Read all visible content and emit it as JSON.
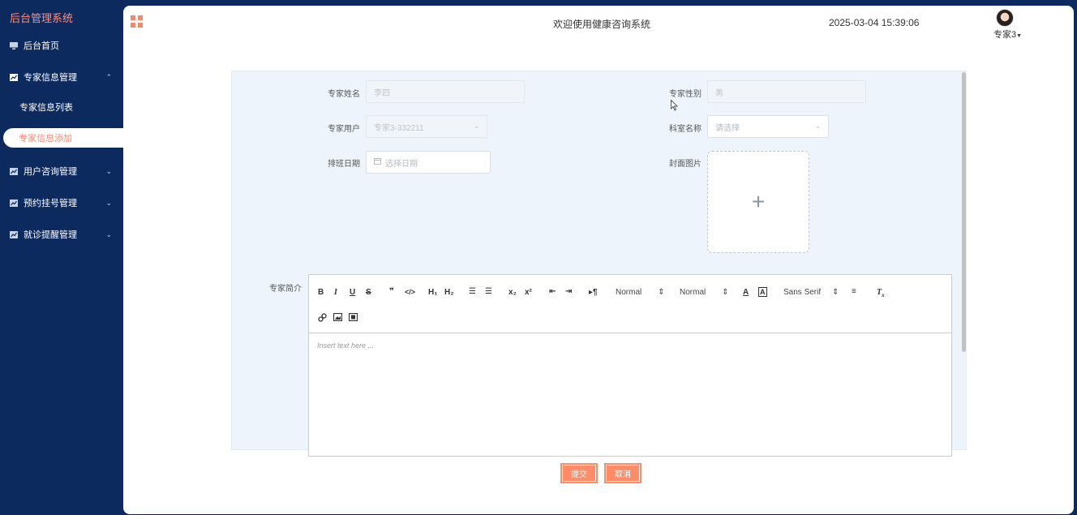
{
  "sidebar": {
    "brand": "后台管理系统",
    "items": [
      {
        "label": "后台首页",
        "icon": "monitor-icon"
      },
      {
        "label": "专家信息管理",
        "icon": "chart-icon",
        "arrow": "⌃"
      },
      {
        "label": "专家信息列表"
      },
      {
        "label": "专家信息添加"
      },
      {
        "label": "用户咨询管理",
        "icon": "chart-icon",
        "arrow": "⌄"
      },
      {
        "label": "预约挂号管理",
        "icon": "chart-icon",
        "arrow": "⌄"
      },
      {
        "label": "就诊提醒管理",
        "icon": "chart-icon",
        "arrow": "⌄"
      }
    ]
  },
  "header": {
    "title": "欢迎使用健康咨询系统",
    "datetime": "2025-03-04 15:39:06",
    "user": "专家3"
  },
  "form": {
    "expert_name_label": "专家姓名",
    "expert_name_value": "李四",
    "expert_gender_label": "专家性别",
    "expert_gender_value": "男",
    "expert_user_label": "专家用户",
    "expert_user_value": "专家3-332211",
    "department_label": "科室名称",
    "department_placeholder": "请选择",
    "schedule_label": "排班日期",
    "schedule_placeholder": "选择日期",
    "cover_label": "封面图片",
    "intro_label": "专家简介"
  },
  "editor": {
    "header_select": "Normal",
    "size_select": "Normal",
    "font_select": "Sans Serif",
    "placeholder": "Insert text here ..."
  },
  "actions": {
    "submit": "提交",
    "cancel": "取消"
  },
  "colors": {
    "sidebar_bg": "#0d2a5e",
    "accent": "#ff8c69",
    "form_bg": "#eef4fb"
  }
}
